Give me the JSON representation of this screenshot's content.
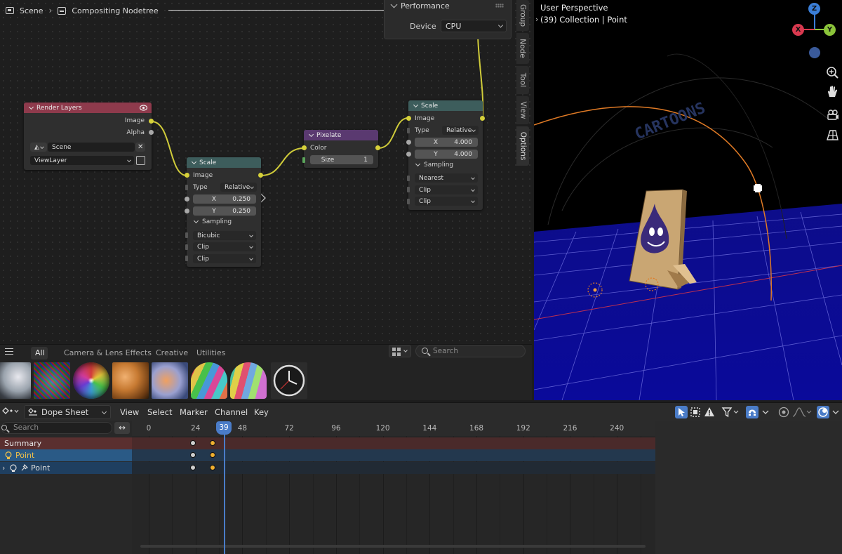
{
  "node_editor": {
    "breadcrumb": [
      "Scene",
      "Compositing Nodetree"
    ],
    "side_tabs": [
      "Group",
      "Node",
      "Tool",
      "View",
      "Options"
    ],
    "performance": {
      "title": "Performance",
      "device_label": "Device",
      "device_value": "CPU"
    },
    "nodes": {
      "render_layers": {
        "title": "Render Layers",
        "out_image": "Image",
        "out_alpha": "Alpha",
        "scene": "Scene",
        "view_layer": "ViewLayer"
      },
      "scale1": {
        "title": "Scale",
        "in_image": "Image",
        "type_label": "Type",
        "type_value": "Relative",
        "x_label": "X",
        "x_value": "0.250",
        "y_label": "Y",
        "y_value": "0.250",
        "sampling": "Sampling",
        "filter": "Bicubic",
        "clip1": "Clip",
        "clip2": "Clip"
      },
      "pixelate": {
        "title": "Pixelate",
        "in_color": "Color",
        "size_label": "Size",
        "size_value": "1"
      },
      "scale2": {
        "title": "Scale",
        "in_image": "Image",
        "type_label": "Type",
        "type_value": "Relative",
        "x_label": "X",
        "x_value": "4.000",
        "y_label": "Y",
        "y_value": "4.000",
        "sampling": "Sampling",
        "filter": "Nearest",
        "clip1": "Clip",
        "clip2": "Clip"
      }
    }
  },
  "asset_browser": {
    "tabs": [
      "All",
      "Camera & Lens Effects",
      "Creative",
      "Utilities"
    ],
    "search_placeholder": "Search"
  },
  "viewport": {
    "title": "User Perspective",
    "subtitle": "(39) Collection | Point",
    "gizmo_labels": {
      "z": "Z",
      "x": "X",
      "y": "Y"
    },
    "colors": {
      "x": "#d9394f",
      "y": "#8bc43a",
      "z": "#3a7ed8"
    }
  },
  "dope_sheet": {
    "editor_type": "Dope Sheet",
    "menus": [
      "View",
      "Select",
      "Marker",
      "Channel",
      "Key"
    ],
    "search_placeholder": "Search",
    "channels": [
      "Summary",
      "Point",
      "Point"
    ],
    "frame_ticks": [
      "0",
      "24",
      "48",
      "72",
      "96",
      "120",
      "144",
      "168",
      "192",
      "216",
      "240"
    ],
    "current_frame": "39"
  }
}
